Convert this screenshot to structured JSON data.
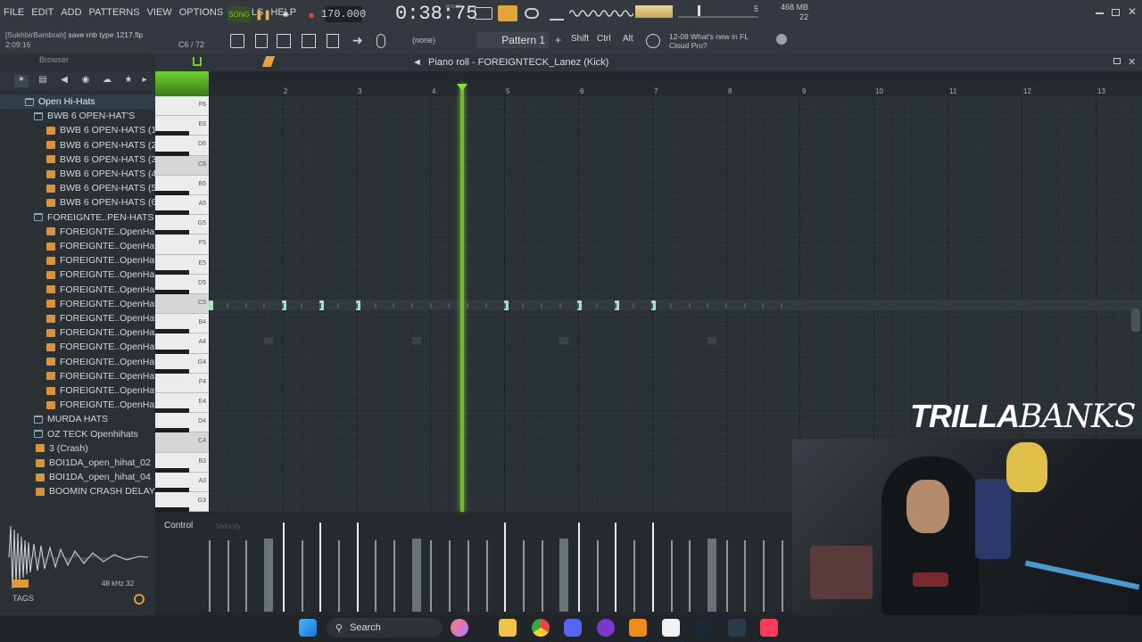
{
  "menu": [
    "FILE",
    "EDIT",
    "ADD",
    "PATTERNS",
    "VIEW",
    "OPTIONS",
    "TOOLS",
    "HELP"
  ],
  "transport": {
    "song_label": "SONG",
    "tempo": "170.000",
    "time": "0:38:75",
    "time_sub": "M:S:CS"
  },
  "cpu": {
    "mem": "468 MB",
    "poly": "22",
    "cores": "5"
  },
  "hint": {
    "user": "[SukhbirBambrah]",
    "project": "save rnb type 1217.flp",
    "time": "2:09:16",
    "pos": "C6 / 72"
  },
  "pattern": {
    "selector": "Pattern 1",
    "none": "(none)",
    "keys": [
      "Shift",
      "Ctrl",
      "Alt"
    ]
  },
  "news": {
    "date": "12-09",
    "title": "What's new in FL",
    "sub": "Cloud Pro?"
  },
  "browser": {
    "title": "Browser",
    "items": [
      {
        "label": "Open Hi-Hats",
        "type": "folder",
        "indent": 0,
        "sel": true
      },
      {
        "label": "BWB 6 OPEN-HAT'S",
        "type": "folder",
        "indent": 1,
        "sel": false
      },
      {
        "label": "BWB 6 OPEN-HATS (1)",
        "type": "file",
        "indent": 2,
        "sel": false
      },
      {
        "label": "BWB 6 OPEN-HATS (2)",
        "type": "file",
        "indent": 2,
        "sel": false
      },
      {
        "label": "BWB 6 OPEN-HATS (3)",
        "type": "file",
        "indent": 2,
        "sel": false
      },
      {
        "label": "BWB 6 OPEN-HATS (4)",
        "type": "file",
        "indent": 2,
        "sel": false
      },
      {
        "label": "BWB 6 OPEN-HATS (5)",
        "type": "file",
        "indent": 2,
        "sel": false
      },
      {
        "label": "BWB 6 OPEN-HATS (6)",
        "type": "file",
        "indent": 2,
        "sel": false
      },
      {
        "label": "FOREIGNTE..PEN-HATS",
        "type": "folder",
        "indent": 1,
        "sel": false
      },
      {
        "label": "FOREIGNTE..OpenHat)",
        "type": "file",
        "indent": 2,
        "sel": false
      },
      {
        "label": "FOREIGNTE..OpenHat)",
        "type": "file",
        "indent": 2,
        "sel": false
      },
      {
        "label": "FOREIGNTE..OpenHat)",
        "type": "file",
        "indent": 2,
        "sel": false
      },
      {
        "label": "FOREIGNTE..OpenHat)",
        "type": "file",
        "indent": 2,
        "sel": false
      },
      {
        "label": "FOREIGNTE..OpenHat)",
        "type": "file",
        "indent": 2,
        "sel": false
      },
      {
        "label": "FOREIGNTE..OpenHat)",
        "type": "file",
        "indent": 2,
        "sel": false
      },
      {
        "label": "FOREIGNTE..OpenHat)",
        "type": "file",
        "indent": 2,
        "sel": false
      },
      {
        "label": "FOREIGNTE..OpenHat)",
        "type": "file",
        "indent": 2,
        "sel": false
      },
      {
        "label": "FOREIGNTE..OpenHat)",
        "type": "file",
        "indent": 2,
        "sel": false
      },
      {
        "label": "FOREIGNTE..OpenHat)",
        "type": "file",
        "indent": 2,
        "sel": false
      },
      {
        "label": "FOREIGNTE..OpenHat)",
        "type": "file",
        "indent": 2,
        "sel": false
      },
      {
        "label": "FOREIGNTE..OpenHat)",
        "type": "file",
        "indent": 2,
        "sel": false
      },
      {
        "label": "FOREIGNTE..OpenHat)",
        "type": "file",
        "indent": 2,
        "sel": false
      },
      {
        "label": "MURDA HATS",
        "type": "folder",
        "indent": 1,
        "sel": false
      },
      {
        "label": "OZ TECK Openhihats",
        "type": "folder",
        "indent": 1,
        "sel": false
      },
      {
        "label": "3 (Crash)",
        "type": "file",
        "indent": 1,
        "sel": false
      },
      {
        "label": "BOI1DA_open_hihat_02",
        "type": "file",
        "indent": 1,
        "sel": false
      },
      {
        "label": "BOI1DA_open_hihat_04",
        "type": "file",
        "indent": 1,
        "sel": false
      },
      {
        "label": "BOOMIN CRASH DELAY",
        "type": "file",
        "indent": 1,
        "sel": false
      }
    ],
    "sample_info": "48 kHz 32",
    "tags": "TAGS"
  },
  "piano_roll": {
    "title": "Piano roll - FOREIGNTECK_Lanez (Kick)",
    "bars": [
      "2",
      "3",
      "4",
      "5",
      "6",
      "7",
      "8",
      "9",
      "10",
      "11",
      "12",
      "13"
    ],
    "key_labels": [
      "F6",
      "E6",
      "D6",
      "C6",
      "B5",
      "A5",
      "G5",
      "F5",
      "E5",
      "D5",
      "C5",
      "B4",
      "A4",
      "G4",
      "F4",
      "E4",
      "D4",
      "C4",
      "B3",
      "A3",
      "G3"
    ],
    "control_label": "Control",
    "control_param": "Velocity"
  },
  "overlay": {
    "brand_a": "TRILLA",
    "brand_b": "BANKS"
  },
  "taskbar": {
    "search": "Search"
  }
}
